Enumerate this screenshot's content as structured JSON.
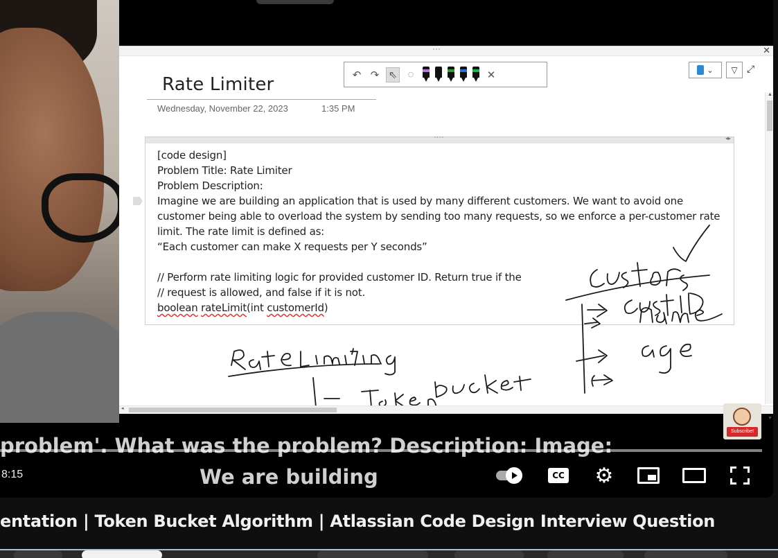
{
  "onenote": {
    "page_title": "Rate Limiter",
    "date": "Wednesday, November 22, 2023",
    "time": "1:35 PM",
    "note_lines": [
      "[code design]",
      "Problem Title: Rate Limiter",
      "Problem Description:",
      "Imagine we are building an application that is used by many different customers. We want to avoid one customer being able to overload the system by sending too many requests, so we enforce a per-customer rate limit. The rate limit is defined as:",
      "“Each customer can make X requests per Y seconds”",
      "",
      "// Perform rate limiting logic for provided customer ID. Return true if the",
      "// request is allowed, and false if it is not."
    ],
    "code_words": [
      "boolean",
      "rateLimit",
      "(int ",
      "customerId",
      ")"
    ],
    "pen_colors": [
      "#b07ad6",
      "#111111",
      "#2e9a3a",
      "#2b6fd6",
      "#1bb34a"
    ],
    "ink_color": "#1a1a1a"
  },
  "captions": {
    "line1": "problem'. What was the problem? Description: Image:",
    "line2": "We are building"
  },
  "player": {
    "time": "8:15",
    "cc_label": "CC",
    "progress_fraction": 1.0
  },
  "subscribe_badge": "Subscribe!",
  "video_title": "entation | Token Bucket Algorithm | Atlassian Code Design Interview Question"
}
